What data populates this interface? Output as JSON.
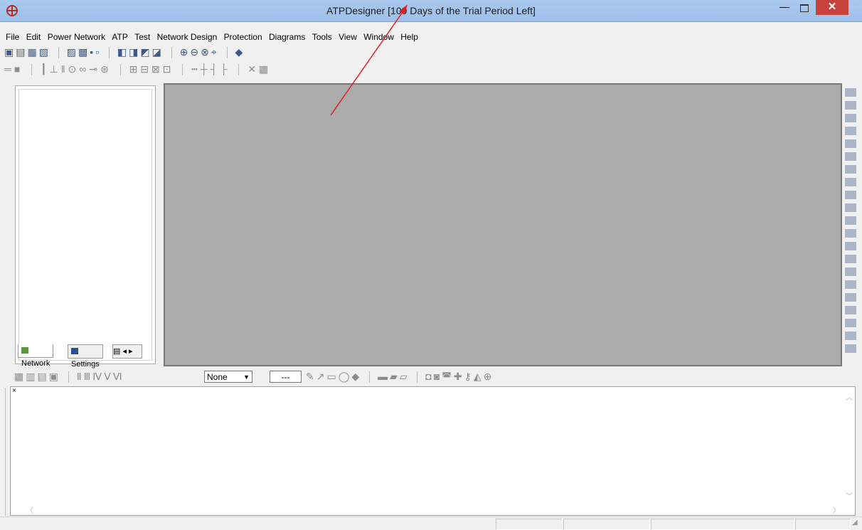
{
  "window": {
    "title": "ATPDesigner  [109 Days of the Trial Period Left]",
    "min_glyph": "—",
    "close_glyph": "✕"
  },
  "menu": [
    "File",
    "Edit",
    "Power Network",
    "ATP",
    "Test",
    "Network Design",
    "Protection",
    "Diagrams",
    "Tools",
    "View",
    "Window",
    "Help"
  ],
  "left_panel": {
    "tabs": {
      "network": "Network",
      "settings": "Settings"
    }
  },
  "bottom_toolbar": {
    "select_value": "None",
    "dashes_value": "---"
  },
  "output": {
    "close_glyph": "×"
  },
  "icons": {
    "app": "atp-logo-icon",
    "toolbar": [
      "new-icon",
      "open-icon",
      "save-icon",
      "print-icon",
      "find-icon",
      "copy-icon",
      "paste-icon",
      "zoom-in-icon",
      "zoom-out-icon",
      "binoculars-icon",
      "help-icon"
    ]
  }
}
